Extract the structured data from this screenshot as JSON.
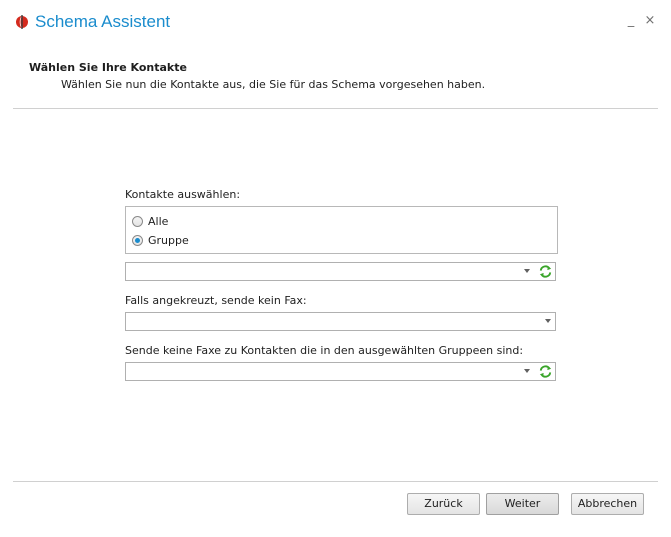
{
  "window": {
    "title": "Schema Assistent",
    "minimize_glyph": "_",
    "close_glyph": "×",
    "accent": "#1a8ccd"
  },
  "header": {
    "title": "Wählen Sie Ihre Kontakte",
    "subtitle": "Wählen Sie nun die Kontakte aus, die Sie für das Schema vorgesehen haben."
  },
  "form": {
    "select_contacts_label": "Kontakte auswählen:",
    "radio_options": [
      {
        "label": "Alle",
        "selected": false
      },
      {
        "label": "Gruppe",
        "selected": true
      }
    ],
    "group_combo": {
      "value": "",
      "icon": "refresh-icon"
    },
    "no_fax_label": "Falls angekreuzt, sende kein Fax:",
    "no_fax_combo": {
      "value": ""
    },
    "exclude_groups_label": "Sende keine Faxe zu Kontakten die in den ausgewählten Gruppeen sind:",
    "exclude_groups_combo": {
      "value": "",
      "icon": "refresh-icon"
    }
  },
  "buttons": {
    "back": "Zurück",
    "next": "Weiter",
    "cancel": "Abbrechen"
  }
}
